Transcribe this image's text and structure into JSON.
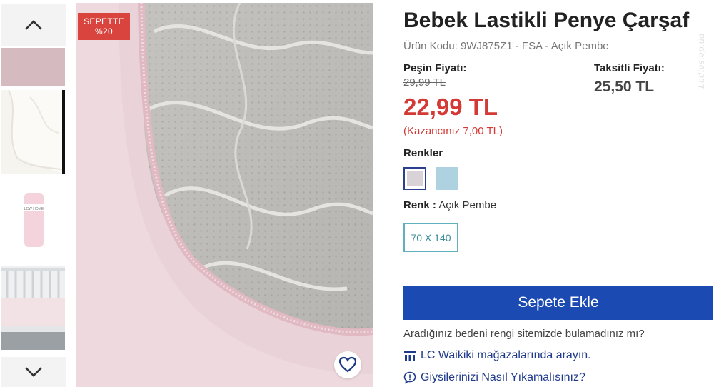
{
  "product": {
    "title": "Bebek Lastikli Penye Çarşaf",
    "sku_line": "Ürün Kodu: 9WJ875Z1 - FSA - Açık Pembe"
  },
  "pricing": {
    "cash_label": "Peşin Fiyatı:",
    "old_price": "29,99 TL",
    "new_price": "22,99 TL",
    "savings": "(Kazancınız 7,00 TL)",
    "installment_label": "Taksitli Fiyatı:",
    "installment_price": "25,50 TL"
  },
  "badge": {
    "line1": "SEPETTE",
    "line2": "%20",
    "color": "#d9443f"
  },
  "colors": {
    "label": "Renkler",
    "options": [
      {
        "name": "Açık Pembe",
        "hex": "#d9d2d6",
        "selected": true
      },
      {
        "name": "Açık Mavi",
        "hex": "#aed2e0",
        "selected": false
      }
    ],
    "selected_label": "Renk :",
    "selected_value": "Açık Pembe"
  },
  "size": {
    "options": [
      "70 X 140"
    ]
  },
  "cart": {
    "button_label": "Sepete Ekle",
    "color": "#1b4ab3"
  },
  "help": {
    "text": "Aradığınız bedeni rengi sitemizde bulamadınız mı?",
    "store_link": "LC Waikiki mağazalarında arayın.",
    "wash_link": "Giysilerinizi Nasıl Yıkamalısınız?"
  },
  "thumbnail_text": "LCW HOME",
  "watermark": "Ladies.ep.ua",
  "icons": {
    "up": "chevron-up-icon",
    "down": "chevron-down-icon",
    "favorite": "heart-icon",
    "store": "store-icon",
    "wash": "info-bubble-icon"
  },
  "price_color": "#d33a36"
}
